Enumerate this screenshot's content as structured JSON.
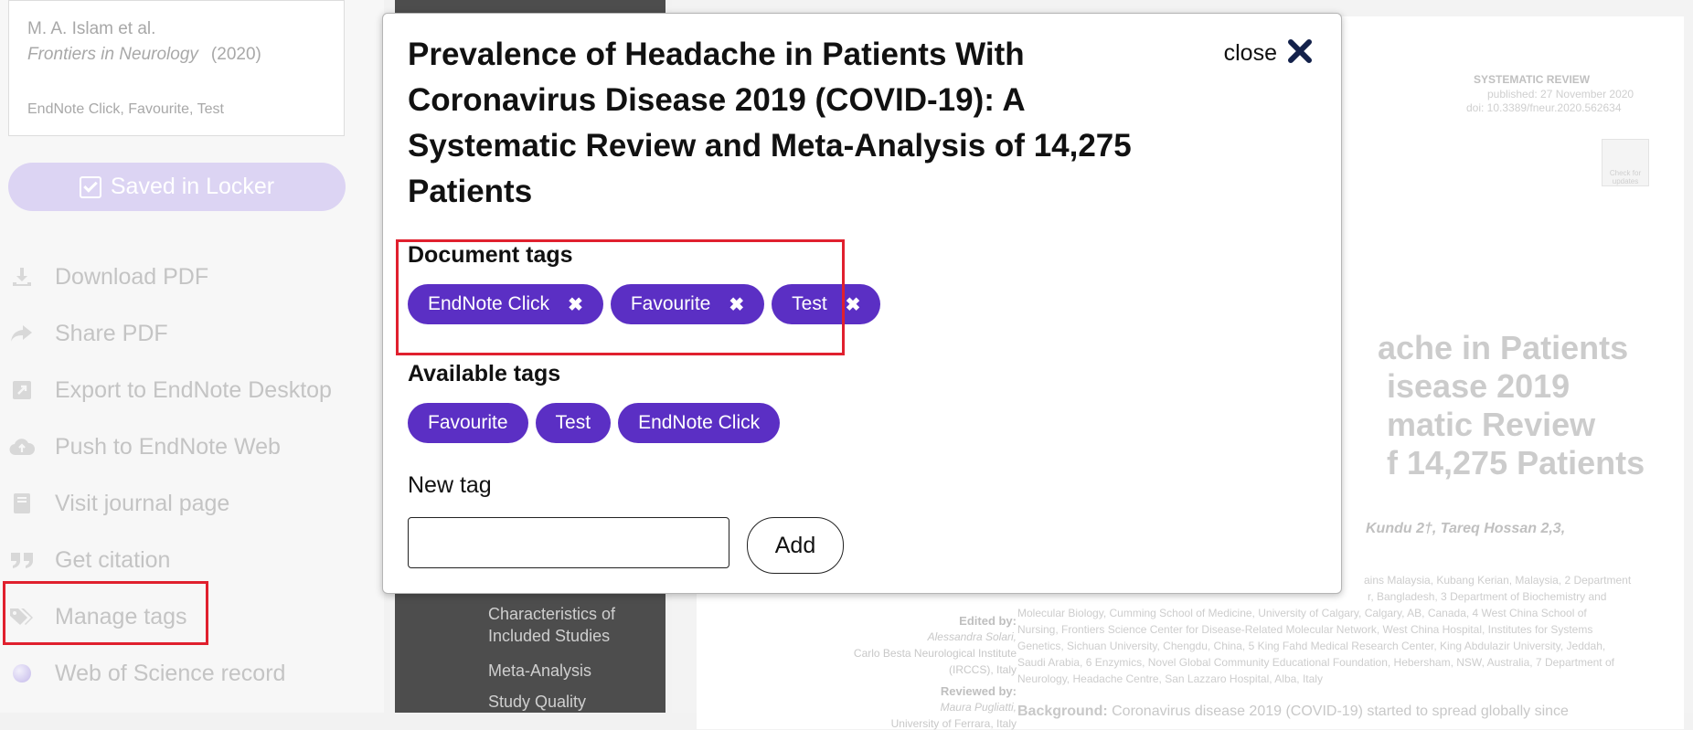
{
  "sidebar": {
    "reference": {
      "authors": "M. A. Islam et al.",
      "journal": "Frontiers in Neurology",
      "year": "(2020)",
      "tags": "EndNote Click, Favourite, Test"
    },
    "saved_label": "Saved in Locker",
    "menu": [
      {
        "label": "Download PDF",
        "icon": "download-icon"
      },
      {
        "label": "Share PDF",
        "icon": "share-icon"
      },
      {
        "label": "Export to EndNote Desktop",
        "icon": "export-icon"
      },
      {
        "label": "Push to EndNote Web",
        "icon": "cloud-upload-icon"
      },
      {
        "label": "Visit journal page",
        "icon": "journal-icon"
      },
      {
        "label": "Get citation",
        "icon": "quote-icon"
      },
      {
        "label": "Manage tags",
        "icon": "tags-icon"
      },
      {
        "label": "Web of Science record",
        "icon": "globe-icon"
      }
    ]
  },
  "toc": {
    "items": [
      "Characteristics of Included Studies",
      "Meta-Analysis",
      "Study Quality"
    ]
  },
  "paper": {
    "section": "SYSTEMATIC REVIEW",
    "published": "published: 27 November 2020",
    "doi": "doi: 10.3389/fneur.2020.562634",
    "check_updates": "Check for updates",
    "title_lines": [
      "ache in Patients",
      "isease 2019",
      "matic Review",
      "f 14,275 Patients"
    ],
    "authors": "Kundu 2†, Tareq Hossan 2,3,",
    "edited_by": "Edited by:",
    "editor": "Alessandra Solari,",
    "editor_affil_1": "Carlo Besta Neurological Institute",
    "editor_affil_2": "(IRCCS), Italy",
    "reviewed_by": "Reviewed by:",
    "reviewer": "Maura Pugliatti,",
    "reviewer_affil": "University of Ferrara, Italy",
    "affiliations": [
      "ains Malaysia, Kubang Kerian, Malaysia, 2 Department",
      "r, Bangladesh, 3 Department of Biochemistry and",
      "Molecular Biology, Cumming School of Medicine, University of Calgary, Calgary, AB, Canada, 4 West China School of",
      "Nursing, Frontiers Science Center for Disease-Related Molecular Network, West China Hospital, Institutes for Systems",
      "Genetics, Sichuan University, Chengdu, China, 5 King Fahd Medical Research Center, King Abdulazir University, Jeddah,",
      "Saudi Arabia, 6 Enzymics, Novel Global Community Educational Foundation, Hebersham, NSW, Australia, 7 Department of",
      "Neurology, Headache Centre, San Lazzaro Hospital, Alba, Italy"
    ],
    "background_label": "Background:",
    "background_text": "Coronavirus disease 2019 (COVID-19) started to spread globally since"
  },
  "modal": {
    "title": "Prevalence of Headache in Patients With Coronavirus Disease 2019 (COVID-19): A Systematic Review and Meta-Analysis of 14,275 Patients",
    "close_label": "close",
    "document_tags_label": "Document tags",
    "document_tags": [
      "EndNote Click",
      "Favourite",
      "Test"
    ],
    "available_tags_label": "Available tags",
    "available_tags": [
      "Favourite",
      "Test",
      "EndNote Click"
    ],
    "new_tag_label": "New tag",
    "new_tag_value": "",
    "add_label": "Add"
  },
  "colors": {
    "tag": "#5b2fc4",
    "saved_button": "#dcd4f3",
    "highlight": "#e0202e"
  }
}
